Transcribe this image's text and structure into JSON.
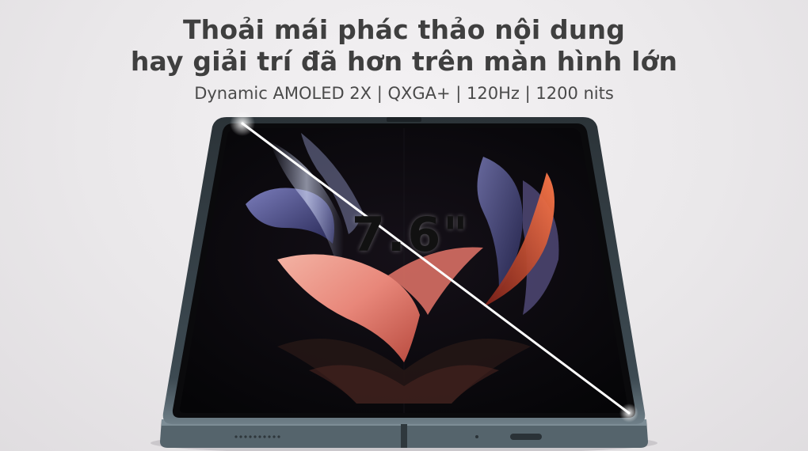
{
  "headline": {
    "line1": "Thoải mái phác thảo nội dung",
    "line2": "hay giải trí đã hơn trên màn hình lớn"
  },
  "specs_line": "Dynamic AMOLED 2X | QXGA+ | 120Hz | 1200 nits",
  "screen_size_label": "7.6\"",
  "colors": {
    "background": "#eceaec",
    "headline": "#3f3f3f",
    "device_frame": "#3c4a52",
    "wallpaper_pink": "#e8877a",
    "wallpaper_orange": "#e0522e",
    "wallpaper_blue": "#5a5fb0"
  }
}
